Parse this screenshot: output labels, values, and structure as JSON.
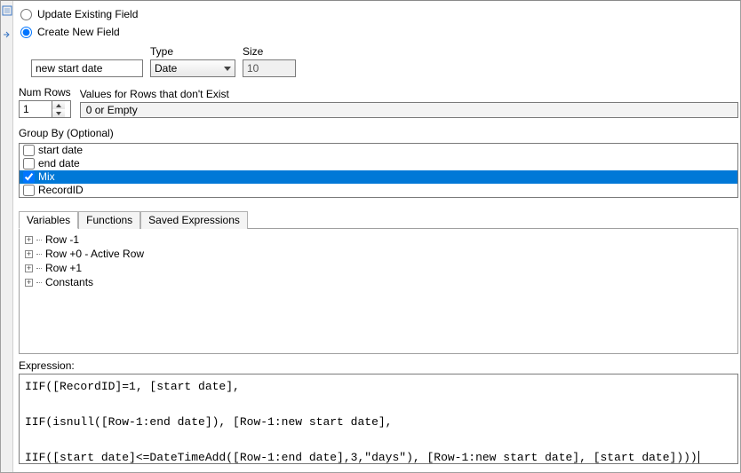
{
  "mode": {
    "update_label": "Update Existing Field",
    "create_label": "Create New  Field"
  },
  "field": {
    "name_value": "new start date",
    "type_label": "Type",
    "type_value": "Date",
    "size_label": "Size",
    "size_value": "10"
  },
  "numrows": {
    "label": "Num Rows",
    "value": "1",
    "values_label": "Values for Rows that don't Exist",
    "values_value": "0 or Empty"
  },
  "groupby": {
    "label": "Group By (Optional)",
    "items": [
      {
        "label": "start date",
        "checked": false,
        "selected": false
      },
      {
        "label": "end date",
        "checked": false,
        "selected": false
      },
      {
        "label": "Mix",
        "checked": true,
        "selected": true
      },
      {
        "label": "RecordID",
        "checked": false,
        "selected": false
      }
    ]
  },
  "tabs": {
    "variables": "Variables",
    "functions": "Functions",
    "saved": "Saved Expressions"
  },
  "tree": {
    "items": [
      "Row -1",
      "Row +0 - Active Row",
      "Row +1",
      "Constants"
    ]
  },
  "expression": {
    "label": "Expression:",
    "text": "IIF([RecordID]=1, [start date],\n\nIIF(isnull([Row-1:end date]), [Row-1:new start date],\n\nIIF([start date]<=DateTimeAdd([Row-1:end date],3,\"days\"), [Row-1:new start date], [start date])))"
  }
}
